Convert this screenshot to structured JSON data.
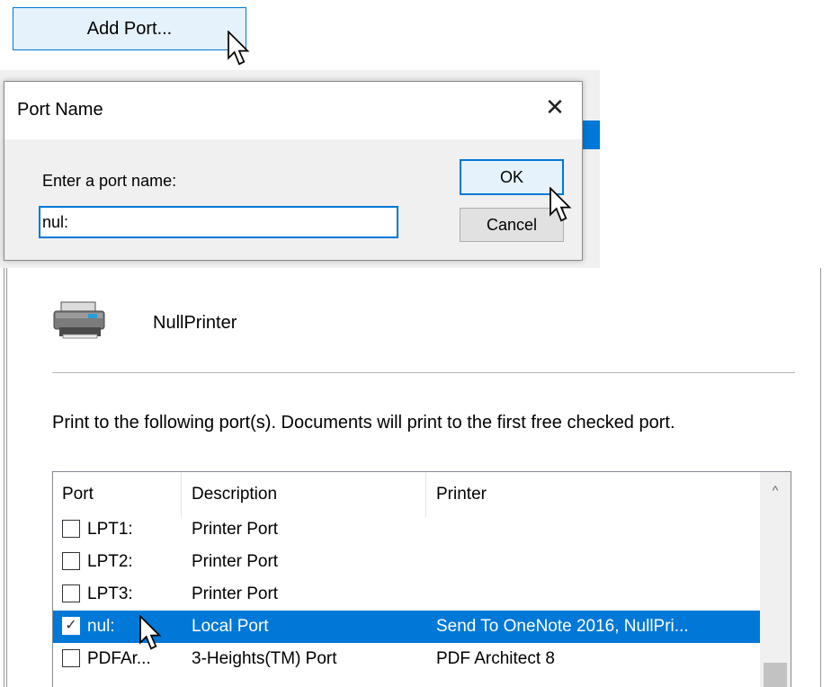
{
  "add_port_button": {
    "label": "Add Port..."
  },
  "dialog": {
    "title": "Port Name",
    "close_glyph": "✕",
    "prompt": "Enter a port name:",
    "input_value": "nul:",
    "ok_label": "OK",
    "cancel_label": "Cancel"
  },
  "printer": {
    "name": "NullPrinter",
    "ports_description": "Print to the following port(s). Documents will print to the first free checked port."
  },
  "ports_table": {
    "columns": [
      "Port",
      "Description",
      "Printer"
    ],
    "rows": [
      {
        "checked": false,
        "port": "LPT1:",
        "description": "Printer Port",
        "printer": ""
      },
      {
        "checked": false,
        "port": "LPT2:",
        "description": "Printer Port",
        "printer": ""
      },
      {
        "checked": false,
        "port": "LPT3:",
        "description": "Printer Port",
        "printer": ""
      },
      {
        "checked": true,
        "port": "nul:",
        "description": "Local Port",
        "printer": "Send To OneNote 2016, NullPri...",
        "selected": true
      },
      {
        "checked": false,
        "port": "PDFAr...",
        "description": "3-Heights(TM) Port",
        "printer": "PDF Architect 8"
      }
    ],
    "scroll_up_glyph": "^"
  },
  "colors": {
    "accent": "#0078d7",
    "button_hover_fill": "#e5f1fb",
    "dialog_background": "#f0f0f0"
  },
  "icons": [
    "arrow-cursor-icon",
    "close-icon",
    "printer-icon",
    "checkbox-icon",
    "scroll-up-icon"
  ]
}
